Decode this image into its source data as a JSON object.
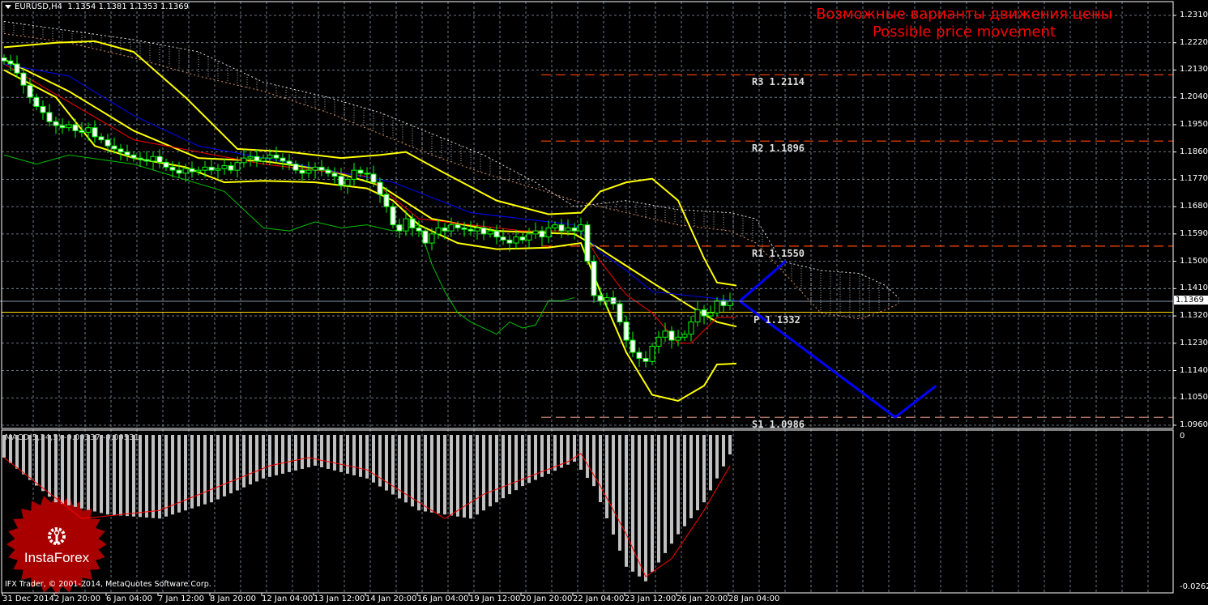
{
  "header": {
    "symbol": "EURUSD,H4",
    "open": "1.1354",
    "high": "1.1381",
    "low": "1.1353",
    "close": "1.1369"
  },
  "annotation": {
    "line1": "Возможные варианты движения цены",
    "line2": "Possible price movement"
  },
  "macd_header": "MACD(5,34,5) -0.00337 -0.00531",
  "copyright": "IFX Trader, © 2001-2014, MetaQuotes Software Corp.",
  "logo_text": "InstaForex",
  "colors": {
    "background": "#000000",
    "grid": "#8a9aa8",
    "bull_outline": "#00ff00",
    "bear_body": "#ffffff",
    "band": "#ffff00",
    "tenkan": "#ff0000",
    "kijun": "#0000ff",
    "chikou": "#00c000",
    "forecast": "#0000ff",
    "resistance": "#ff4500",
    "pivot": "#ffd700",
    "support": "#c08070",
    "macd_hist": "#c0c0c0",
    "macd_signal": "#ff0000"
  },
  "chart_data": {
    "type": "candlestick",
    "symbol": "EURUSD",
    "timeframe": "H4",
    "price_axis": {
      "ticks": [
        "1.2310",
        "1.2220",
        "1.2130",
        "1.2040",
        "1.1950",
        "1.1860",
        "1.1770",
        "1.1680",
        "1.1590",
        "1.1500",
        "1.1410",
        "1.1320",
        "1.1230",
        "1.1140",
        "1.1050",
        "1.0960"
      ],
      "current": "1.1369"
    },
    "time_axis": {
      "ticks": [
        "31 Dec 2014",
        "2 Jan 20:00",
        "6 Jan 04:00",
        "7 Jan 12:00",
        "8 Jan 20:00",
        "12 Jan 04:00",
        "13 Jan 12:00",
        "14 Jan 20:00",
        "16 Jan 04:00",
        "19 Jan 12:00",
        "20 Jan 20:00",
        "22 Jan 04:00",
        "23 Jan 12:00",
        "26 Jan 20:00",
        "28 Jan 04:00"
      ]
    },
    "closes": [
      1.216,
      1.215,
      1.212,
      1.208,
      1.204,
      1.201,
      1.199,
      1.196,
      1.1947,
      1.194,
      1.195,
      1.193,
      1.1925,
      1.194,
      1.191,
      1.19,
      1.188,
      1.187,
      1.186,
      1.185,
      1.184,
      1.1835,
      1.183,
      1.1845,
      1.1826,
      1.181,
      1.18,
      1.179,
      1.1805,
      1.1795,
      1.18,
      1.181,
      1.18,
      1.1805,
      1.1815,
      1.18,
      1.1825,
      1.184,
      1.1845,
      1.183,
      1.184,
      1.185,
      1.184,
      1.183,
      1.182,
      1.18,
      1.179,
      1.18,
      1.181,
      1.18,
      1.179,
      1.178,
      1.175,
      1.177,
      1.18,
      1.179,
      1.1787,
      1.176,
      1.172,
      1.168,
      1.162,
      1.16,
      1.164,
      1.161,
      1.16,
      1.156,
      1.159,
      1.161,
      1.16,
      1.162,
      1.161,
      1.1605,
      1.16,
      1.161,
      1.159,
      1.16,
      1.158,
      1.157,
      1.156,
      1.158,
      1.157,
      1.159,
      1.16,
      1.158,
      1.161,
      1.162,
      1.16,
      1.161,
      1.16,
      1.162,
      1.15,
      1.1387,
      1.137,
      1.138,
      1.136,
      1.13,
      1.124,
      1.12,
      1.118,
      1.117,
      1.122,
      1.125,
      1.127,
      1.124,
      1.125,
      1.126,
      1.13,
      1.134,
      1.132,
      1.133,
      1.137,
      1.1354,
      1.1369
    ],
    "indicators": {
      "band_upper": [
        [
          0,
          1.2205
        ],
        [
          8,
          1.222
        ],
        [
          14,
          1.2225
        ],
        [
          20,
          1.219
        ],
        [
          28,
          1.204
        ],
        [
          36,
          1.187
        ],
        [
          44,
          1.186
        ],
        [
          52,
          1.184
        ],
        [
          58,
          1.185
        ],
        [
          62,
          1.186
        ],
        [
          68,
          1.179
        ],
        [
          76,
          1.17
        ],
        [
          84,
          1.1655
        ],
        [
          89,
          1.166
        ],
        [
          92,
          1.173
        ],
        [
          96,
          1.176
        ],
        [
          100,
          1.1772
        ],
        [
          104,
          1.17
        ],
        [
          108,
          1.151
        ],
        [
          110,
          1.143
        ],
        [
          113,
          1.142
        ]
      ],
      "band_middle": [
        [
          0,
          1.2165
        ],
        [
          10,
          1.206
        ],
        [
          20,
          1.193
        ],
        [
          30,
          1.184
        ],
        [
          40,
          1.183
        ],
        [
          50,
          1.18
        ],
        [
          58,
          1.175
        ],
        [
          66,
          1.164
        ],
        [
          76,
          1.16
        ],
        [
          88,
          1.159
        ],
        [
          92,
          1.154
        ],
        [
          100,
          1.143
        ],
        [
          106,
          1.135
        ],
        [
          110,
          1.13
        ],
        [
          113,
          1.1285
        ]
      ],
      "band_lower": [
        [
          0,
          1.213
        ],
        [
          8,
          1.204
        ],
        [
          14,
          1.188
        ],
        [
          20,
          1.184
        ],
        [
          28,
          1.181
        ],
        [
          34,
          1.176
        ],
        [
          40,
          1.1765
        ],
        [
          48,
          1.176
        ],
        [
          56,
          1.174
        ],
        [
          60,
          1.17
        ],
        [
          64,
          1.162
        ],
        [
          70,
          1.156
        ],
        [
          76,
          1.154
        ],
        [
          84,
          1.1545
        ],
        [
          89,
          1.156
        ],
        [
          92,
          1.14
        ],
        [
          96,
          1.12
        ],
        [
          100,
          1.106
        ],
        [
          104,
          1.104
        ],
        [
          108,
          1.109
        ],
        [
          110,
          1.116
        ],
        [
          113,
          1.1163
        ]
      ],
      "tenkan": [
        [
          0,
          1.215
        ],
        [
          20,
          1.19
        ],
        [
          40,
          1.182
        ],
        [
          56,
          1.178
        ],
        [
          64,
          1.164
        ],
        [
          80,
          1.16
        ],
        [
          89,
          1.16
        ],
        [
          92,
          1.15
        ],
        [
          96,
          1.139
        ],
        [
          100,
          1.133
        ],
        [
          104,
          1.123
        ],
        [
          106,
          1.123
        ],
        [
          110,
          1.1315
        ],
        [
          113,
          1.1315
        ]
      ],
      "kijun": [
        [
          0,
          1.215
        ],
        [
          10,
          1.211
        ],
        [
          20,
          1.198
        ],
        [
          30,
          1.188
        ],
        [
          45,
          1.182
        ],
        [
          60,
          1.176
        ],
        [
          72,
          1.166
        ],
        [
          88,
          1.162
        ],
        [
          92,
          1.153
        ],
        [
          96,
          1.147
        ],
        [
          100,
          1.14
        ],
        [
          113,
          1.137
        ]
      ],
      "chikou": [
        [
          0,
          1.185
        ],
        [
          5,
          1.182
        ],
        [
          10,
          1.185
        ],
        [
          20,
          1.182
        ],
        [
          34,
          1.173
        ],
        [
          40,
          1.161
        ],
        [
          44,
          1.16
        ],
        [
          48,
          1.163
        ],
        [
          52,
          1.161
        ],
        [
          56,
          1.162
        ],
        [
          60,
          1.16
        ],
        [
          64,
          1.162
        ],
        [
          66,
          1.149
        ],
        [
          68,
          1.14
        ],
        [
          70,
          1.133
        ],
        [
          72,
          1.13
        ],
        [
          74,
          1.128
        ],
        [
          76,
          1.126
        ],
        [
          78,
          1.13
        ],
        [
          80,
          1.128
        ],
        [
          82,
          1.129
        ],
        [
          84,
          1.137
        ],
        [
          86,
          1.137
        ],
        [
          88,
          1.138
        ]
      ],
      "cloud_top": [
        [
          0,
          1.229
        ],
        [
          10,
          1.226
        ],
        [
          20,
          1.223
        ],
        [
          30,
          1.219
        ],
        [
          40,
          1.209
        ],
        [
          50,
          1.204
        ],
        [
          58,
          1.199
        ],
        [
          66,
          1.192
        ],
        [
          74,
          1.185
        ],
        [
          82,
          1.176
        ],
        [
          88,
          1.168
        ],
        [
          96,
          1.17
        ],
        [
          104,
          1.167
        ],
        [
          112,
          1.166
        ],
        [
          116,
          1.164
        ],
        [
          120,
          1.15
        ],
        [
          126,
          1.147
        ],
        [
          132,
          1.146
        ],
        [
          136,
          1.142
        ],
        [
          138,
          1.138
        ]
      ],
      "cloud_bottom": [
        [
          0,
          1.225
        ],
        [
          10,
          1.222
        ],
        [
          20,
          1.217
        ],
        [
          30,
          1.211
        ],
        [
          40,
          1.206
        ],
        [
          50,
          1.199
        ],
        [
          58,
          1.192
        ],
        [
          66,
          1.185
        ],
        [
          74,
          1.179
        ],
        [
          82,
          1.174
        ],
        [
          88,
          1.17
        ],
        [
          96,
          1.166
        ],
        [
          104,
          1.162
        ],
        [
          112,
          1.16
        ],
        [
          116,
          1.156
        ],
        [
          120,
          1.147
        ],
        [
          126,
          1.133
        ],
        [
          132,
          1.131
        ],
        [
          136,
          1.134
        ],
        [
          138,
          1.136
        ]
      ]
    },
    "forecast_up": [
      [
        113.5,
        1.1369
      ],
      [
        120.6,
        1.15
      ]
    ],
    "forecast_down": [
      [
        113.5,
        1.1369
      ],
      [
        137.5,
        1.0986
      ],
      [
        143.8,
        1.109
      ]
    ],
    "pivots": [
      {
        "label": "R3",
        "value": "1.2114",
        "kind": "resistance"
      },
      {
        "label": "R2",
        "value": "1.1896",
        "kind": "resistance"
      },
      {
        "label": "R1",
        "value": "1.1550",
        "kind": "resistance"
      },
      {
        "label": "P",
        "value": "1.1332",
        "kind": "pivot"
      },
      {
        "label": "S1",
        "value": "1.0986",
        "kind": "support"
      }
    ],
    "macd": {
      "axis_ticks": [
        "0",
        "-0.02621"
      ],
      "histogram": [
        [
          0,
          -0.0039
        ],
        [
          8,
          -0.0116
        ],
        [
          16,
          -0.0137
        ],
        [
          24,
          -0.0144
        ],
        [
          32,
          -0.0116
        ],
        [
          40,
          -0.0075
        ],
        [
          48,
          -0.0053
        ],
        [
          56,
          -0.0075
        ],
        [
          64,
          -0.013
        ],
        [
          72,
          -0.0144
        ],
        [
          80,
          -0.0088
        ],
        [
          88,
          -0.0046
        ],
        [
          91,
          -0.0088
        ],
        [
          96,
          -0.0227
        ],
        [
          99,
          -0.0252
        ],
        [
          104,
          -0.0171
        ],
        [
          108,
          -0.0116
        ],
        [
          112,
          -0.00337
        ]
      ],
      "signal": [
        [
          0,
          -0.0039
        ],
        [
          12,
          -0.0144
        ],
        [
          24,
          -0.013
        ],
        [
          41,
          -0.0053
        ],
        [
          47,
          -0.0039
        ],
        [
          56,
          -0.006
        ],
        [
          68,
          -0.0144
        ],
        [
          74,
          -0.0102
        ],
        [
          87,
          -0.0046
        ],
        [
          89,
          -0.0032
        ],
        [
          92,
          -0.0088
        ],
        [
          96,
          -0.0171
        ],
        [
          99,
          -0.0244
        ],
        [
          103,
          -0.0213
        ],
        [
          108,
          -0.013
        ],
        [
          112,
          -0.00531
        ]
      ]
    }
  }
}
